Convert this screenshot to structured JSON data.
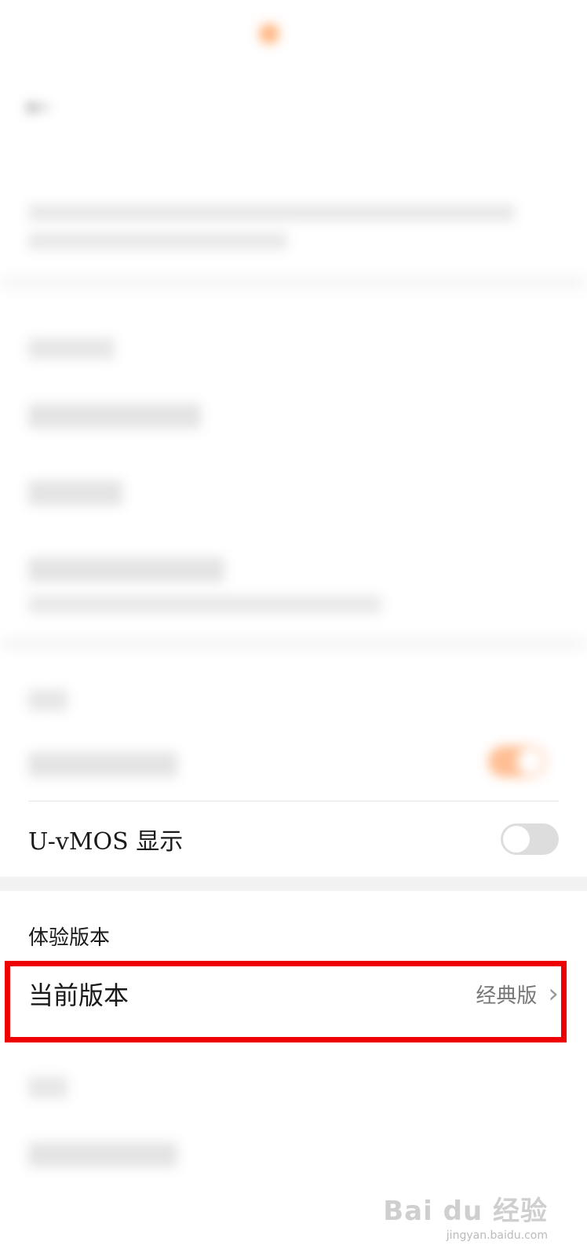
{
  "settings": {
    "display_section": {
      "umos_row": {
        "label": "U-vMOS 显示",
        "toggle_state": "off"
      }
    },
    "experience_section": {
      "title": "体验版本",
      "current_version_row": {
        "label": "当前版本",
        "value": "经典版"
      }
    }
  },
  "watermark": {
    "main": "Bai du 经验",
    "sub": "jingyan.baidu.com"
  },
  "colors": {
    "highlight_border": "#ee0000",
    "toggle_on": "#ff8a3d",
    "toggle_off": "#dddddd"
  },
  "icons": {
    "chevron": "chevron-right-icon"
  }
}
